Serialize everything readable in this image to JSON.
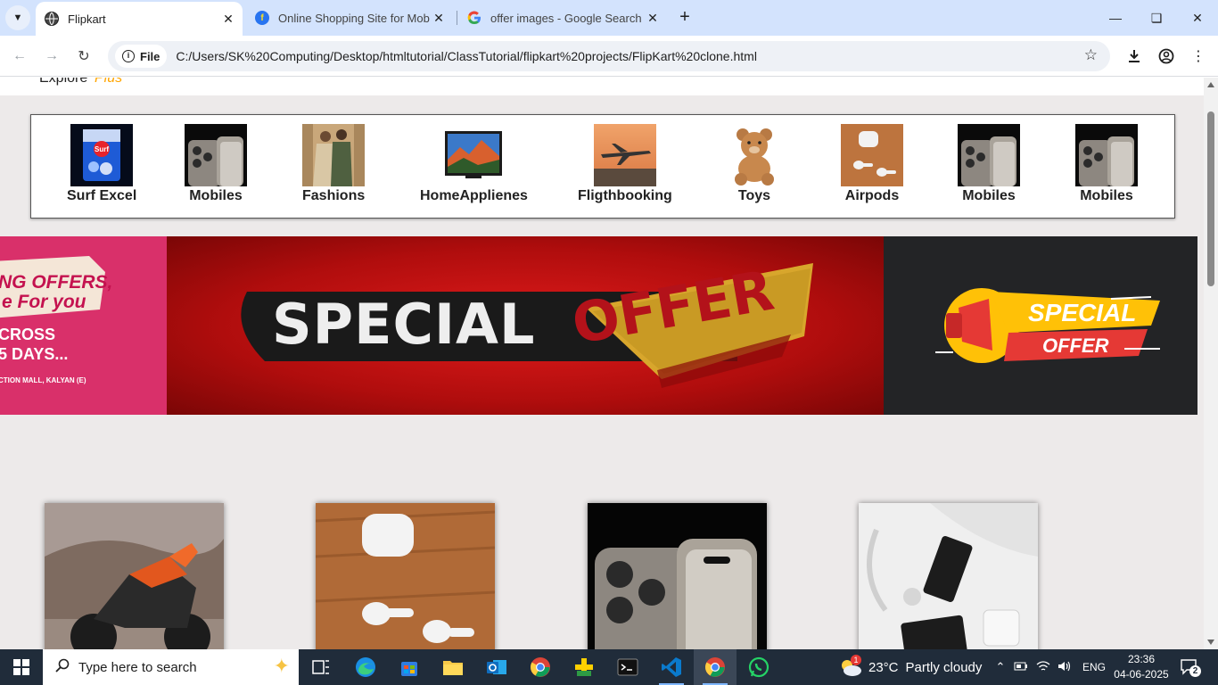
{
  "browser": {
    "tabs": [
      {
        "title": "Flipkart",
        "active": true
      },
      {
        "title": "Online Shopping Site for Mobile",
        "active": false
      },
      {
        "title": "offer images - Google Search",
        "active": false
      }
    ],
    "site_info_label": "File",
    "url": "C:/Users/SK%20Computing/Desktop/htmltutorial/ClassTutorial/flipkart%20projects/FlipKart%20clone.html"
  },
  "page": {
    "nav": {
      "explore": "Explore",
      "plus": "Plus"
    },
    "categories": [
      {
        "label": "Surf Excel"
      },
      {
        "label": "Mobiles"
      },
      {
        "label": "Fashions"
      },
      {
        "label": "HomeApplienes"
      },
      {
        "label": "Fligthbooking"
      },
      {
        "label": "Toys"
      },
      {
        "label": "Airpods"
      },
      {
        "label": "Mobiles"
      },
      {
        "label": "Mobiles"
      }
    ],
    "banners": {
      "left_lines": [
        "NG OFFERS,",
        "e For you",
        "CROSS",
        "5 DAYS...",
        "CTION MALL, KALYAN (E)"
      ],
      "center_word1": "SPECIAL",
      "center_word2": "OFFER",
      "right_word1": "SPECIAL",
      "right_word2": "OFFER"
    },
    "products": [
      {
        "name": "motorbike-image"
      },
      {
        "name": "airpods-image"
      },
      {
        "name": "iphone-image"
      },
      {
        "name": "gadgets-image"
      }
    ]
  },
  "taskbar": {
    "search_placeholder": "Type here to search",
    "weather_temp": "23°C",
    "weather_desc": "Partly cloudy",
    "weather_badge": "1",
    "language": "ENG",
    "time": "23:36",
    "date": "04-06-2025",
    "notification_count": "2"
  },
  "colors": {
    "tabbar_bg": "#d3e3fd",
    "page_bg": "#edeaea",
    "plus_accent": "#ffa500",
    "taskbar_bg": "#202c3a"
  }
}
